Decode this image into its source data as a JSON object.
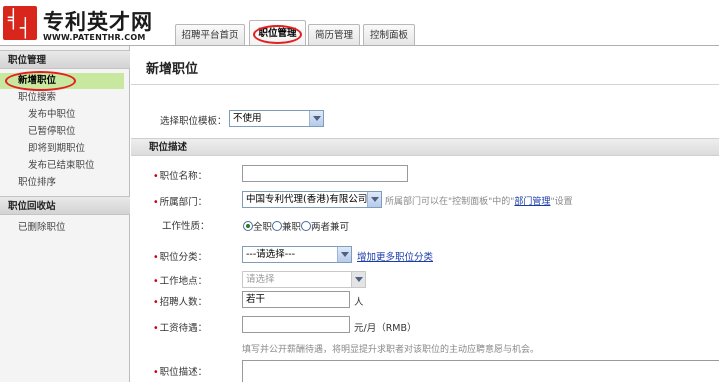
{
  "logo": {
    "name": "专利英才网",
    "url": "WWW.PATENTHR.COM",
    "colors": {
      "mark": "#d8261c"
    }
  },
  "tabs": [
    {
      "label": "招聘平台首页",
      "active": false
    },
    {
      "label": "职位管理",
      "active": true
    },
    {
      "label": "简历管理",
      "active": false
    },
    {
      "label": "控制面板",
      "active": false
    }
  ],
  "sidebar": {
    "sections": [
      {
        "title": "职位管理",
        "items": [
          {
            "label": "新增职位",
            "active": true
          },
          {
            "label": "职位搜索"
          },
          {
            "label": "发布中职位"
          },
          {
            "label": "已暂停职位"
          },
          {
            "label": "即将到期职位"
          },
          {
            "label": "发布已结束职位"
          },
          {
            "label": "职位排序"
          }
        ]
      },
      {
        "title": "职位回收站",
        "items": [
          {
            "label": "已删除职位"
          }
        ]
      }
    ],
    "active_color": "#c7e89e",
    "highlight_ring_color": "#e41f1f"
  },
  "main": {
    "title": "新增职位",
    "template": {
      "label": "选择职位模板：",
      "value": "不使用"
    },
    "section_title": "职位描述",
    "fields": {
      "job_name": {
        "label": "职位名称：",
        "value": ""
      },
      "department": {
        "label": "所属部门：",
        "value": "中国专利代理(香港)有限公司",
        "hint_prefix": "所属部门可以在\"控制面板\"中的\"",
        "hint_link": "部门管理",
        "hint_suffix": "\"设置"
      },
      "job_type": {
        "label": "工作性质：",
        "options": [
          "全职",
          "兼职",
          "两者兼可"
        ],
        "selected": "全职"
      },
      "category": {
        "label": "职位分类：",
        "value": "---请选择---",
        "link": "增加更多职位分类"
      },
      "location": {
        "label": "工作地点：",
        "placeholder": "请选择"
      },
      "headcount": {
        "label": "招聘人数：",
        "value": "若干",
        "unit": "人"
      },
      "salary": {
        "label": "工资待遇：",
        "value": "",
        "unit": "元/月（RMB）",
        "note": "填写并公开薪酬待遇，将明显提升求职者对该职位的主动应聘意愿与机会。"
      },
      "description": {
        "label": "职位描述："
      }
    }
  }
}
